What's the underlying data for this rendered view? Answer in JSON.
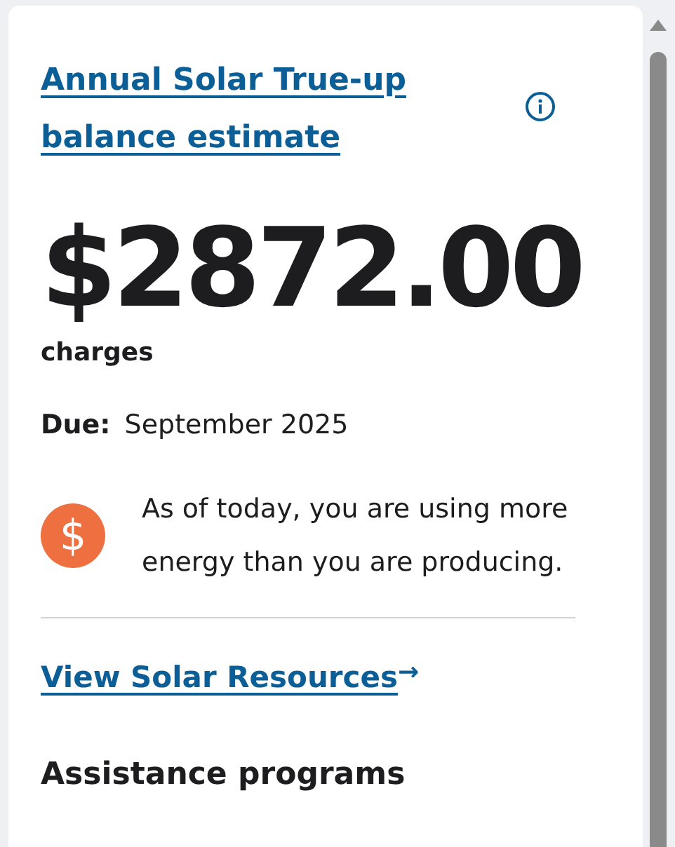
{
  "card": {
    "title": "Annual Solar True-up balance estimate",
    "amount": "$2872.00",
    "amount_label": "charges",
    "due_label": "Due:",
    "due_value": "September 2025",
    "alert": {
      "icon": "$",
      "text": "As of today, you are using more energy than you are producing."
    },
    "link": {
      "label": "View Solar Resources",
      "arrow": "→"
    },
    "section_heading": "Assistance programs"
  }
}
